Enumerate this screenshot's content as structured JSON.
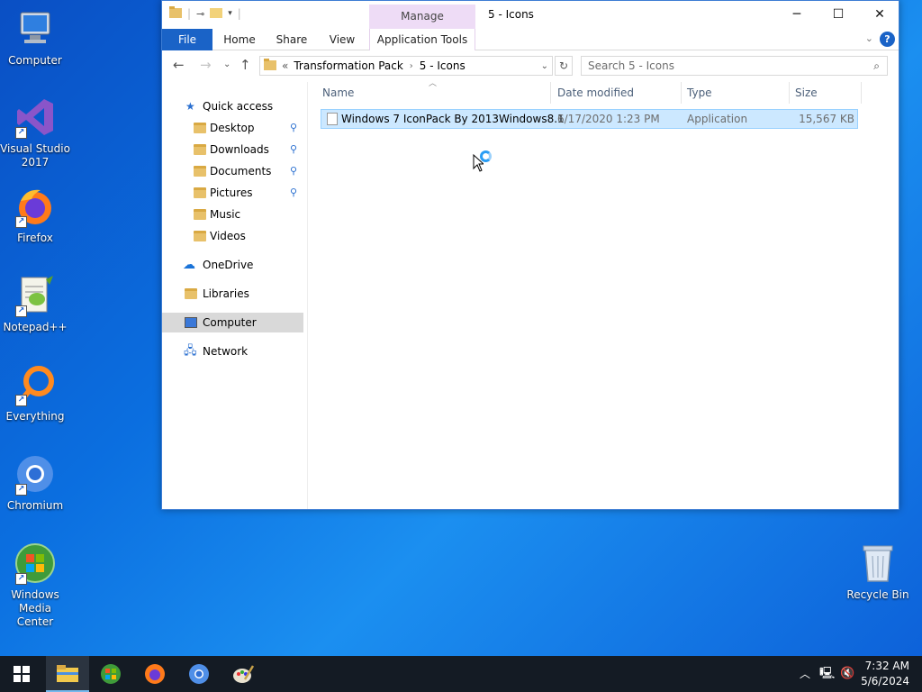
{
  "desktop": {
    "icons": [
      {
        "label": "Computer",
        "icon": "computer-icon"
      },
      {
        "label": "Visual Studio 2017",
        "icon": "visual-studio-icon"
      },
      {
        "label": "Firefox",
        "icon": "firefox-icon"
      },
      {
        "label": "Notepad++",
        "icon": "notepadpp-icon"
      },
      {
        "label": "Everything",
        "icon": "everything-icon"
      },
      {
        "label": "Chromium",
        "icon": "chromium-icon"
      },
      {
        "label": "Windows Media Center",
        "icon": "media-center-icon"
      },
      {
        "label": "Recycle Bin",
        "icon": "recycle-bin-icon"
      }
    ]
  },
  "window": {
    "title": "5 - Icons",
    "context_tab": "Manage",
    "ribbon_tabs": [
      "File",
      "Home",
      "Share",
      "View",
      "Application Tools"
    ],
    "address": {
      "overflow": "«",
      "crumbs": [
        "Transformation Pack",
        "5 - Icons"
      ]
    },
    "search_placeholder": "Search 5 - Icons",
    "nav": {
      "quick_access": "Quick access",
      "pinned": [
        "Desktop",
        "Downloads",
        "Documents",
        "Pictures"
      ],
      "unpinned": [
        "Music",
        "Videos"
      ],
      "onedrive": "OneDrive",
      "libraries": "Libraries",
      "computer": "Computer",
      "network": "Network"
    },
    "columns": [
      "Name",
      "Date modified",
      "Type",
      "Size"
    ],
    "files": [
      {
        "name": "Windows 7 IconPack By 2013Windows8.1",
        "date": "6/17/2020 1:23 PM",
        "type": "Application",
        "size": "15,567 KB"
      }
    ]
  },
  "taskbar": {
    "apps": [
      "file-explorer-icon",
      "media-center-icon",
      "firefox-icon",
      "chromium-icon",
      "paint-icon"
    ],
    "time": "7:32 AM",
    "date": "5/6/2024"
  },
  "colors": {
    "accent": "#1a63c7",
    "selection": "#cce8ff",
    "manage_tab": "#eedcf6"
  }
}
